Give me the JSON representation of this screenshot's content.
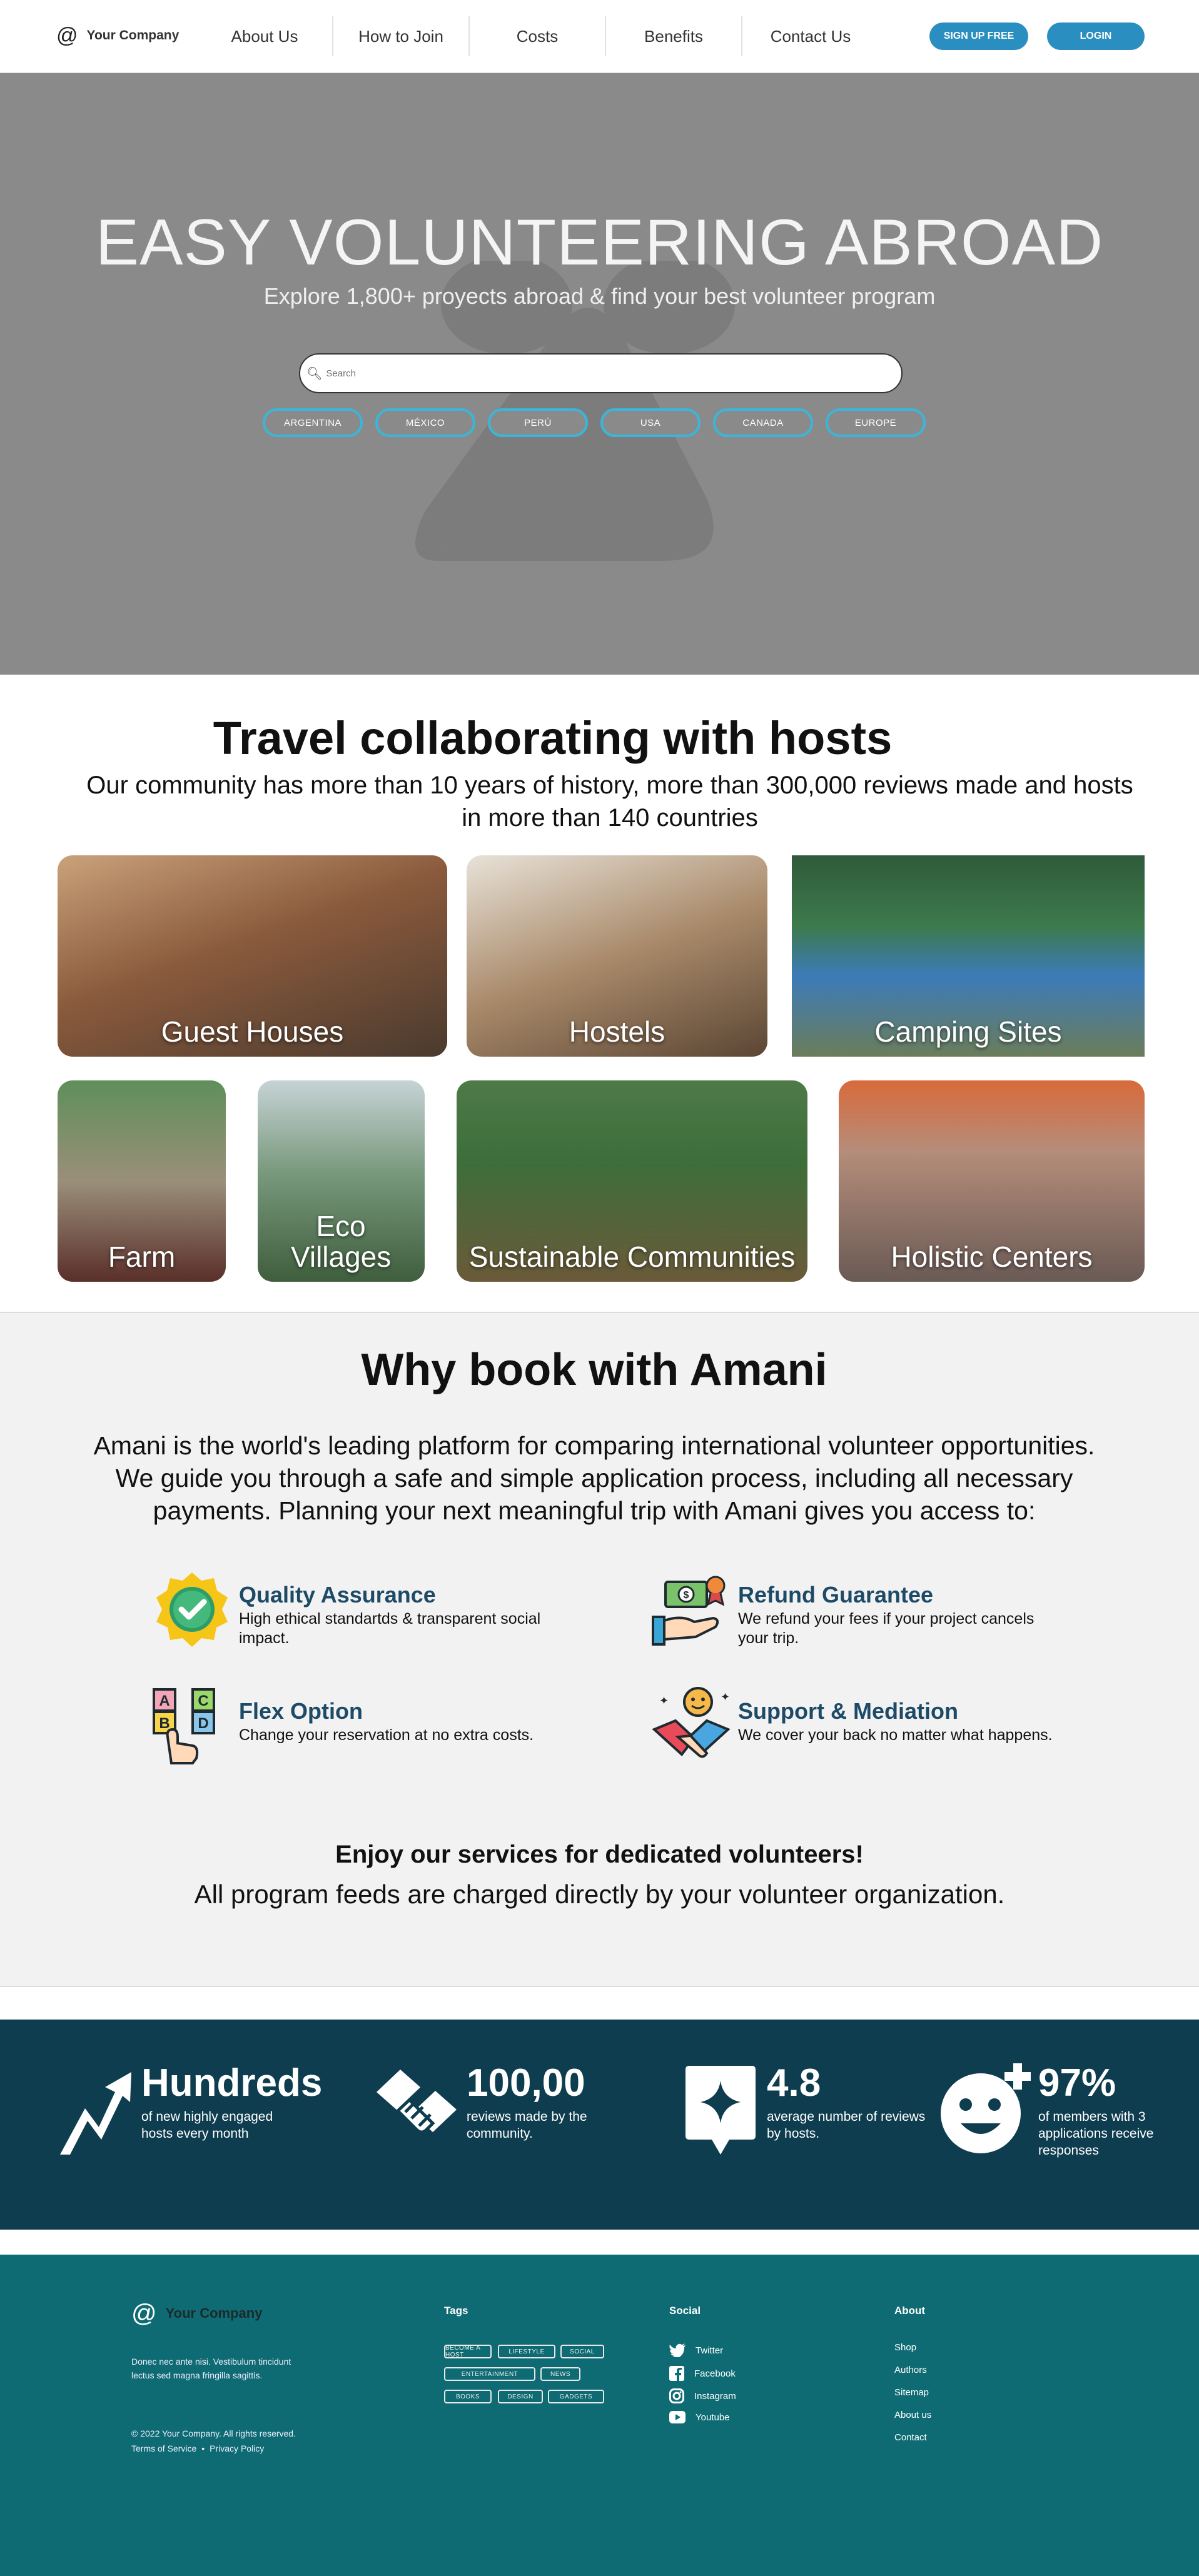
{
  "nav": {
    "company": "Your Company",
    "links": [
      "About Us",
      "How to Join",
      "Costs",
      "Benefits",
      "Contact Us"
    ],
    "signup": "SIGN UP FREE",
    "login": "LOGIN"
  },
  "hero": {
    "title": "EASY VOLUNTEERING ABROAD",
    "subtitle": "Explore 1,800+ proyects abroad & find your best volunteer program",
    "search_placeholder": "Search",
    "countries": [
      "ARGENTINA",
      "MÉXICO",
      "PERÚ",
      "USA",
      "CANADA",
      "EUROPE"
    ]
  },
  "travel": {
    "title": "Travel collaborating with hosts",
    "subtitle": "Our community has more than 10 years of history, more than 300,000 reviews made and hosts in more than 140 countries",
    "cards": [
      "Guest Houses",
      "Hostels",
      "Camping Sites",
      "Farm",
      "Eco Villages",
      "Sustainable Communities",
      "Holistic Centers"
    ]
  },
  "why": {
    "title": "Why book with Amani",
    "intro": "Amani is the world's leading platform for comparing international volunteer opportunities. We guide you through a safe and simple application process, including all necessary payments. Planning your next meaningful trip with Amani gives you access to:",
    "features": [
      {
        "title": "Quality Assurance",
        "desc": "High ethical standartds & transparent social impact.",
        "icon": "quality-badge-icon"
      },
      {
        "title": "Refund Guarantee",
        "desc": "We refund your fees if your project cancels your trip.",
        "icon": "money-hand-icon"
      },
      {
        "title": "Flex Option",
        "desc": "Change your reservation at no extra costs.",
        "icon": "abcd-blocks-icon"
      },
      {
        "title": "Support & Mediation",
        "desc": "We cover your back no matter what happens.",
        "icon": "handshake-icon"
      }
    ],
    "enjoy": "Enjoy our services for dedicated volunteers!",
    "feeds": "All program feeds are charged directly by your volunteer organization."
  },
  "stats": [
    {
      "big": "Hundreds",
      "small": "of new highly engaged hosts every month",
      "icon": "trend-arrow-icon"
    },
    {
      "big": "100,00",
      "small": "reviews made by the community.",
      "icon": "handshake-icon"
    },
    {
      "big": "4.8",
      "small": "average number of reviews by hosts.",
      "icon": "star-badge-icon"
    },
    {
      "big": "97%",
      "small": "of members with 3 applications receive responses",
      "icon": "smiley-plus-icon"
    }
  ],
  "footer": {
    "company": "Your Company",
    "blurb": "Donec nec ante nisi. Vestibulum tincidunt lectus sed magna fringilla sagittis.",
    "copyright": "© 2022 Your Company.  All rights reserved.",
    "terms": "Terms of Service",
    "privacy": "Privacy Policy",
    "tags_title": "Tags",
    "tags": [
      "BECOME A HOST",
      "LIFESTYLE",
      "SOCIAL",
      "ENTERTAINMENT",
      "NEWS",
      "BOOKS",
      "DESIGN",
      "GADGETS"
    ],
    "social_title": "Social",
    "social": [
      "Twitter",
      "Facebook",
      "Instagram",
      "Youtube"
    ],
    "about_title": "About",
    "about": [
      "Shop",
      "Authors",
      "Sitemap",
      "About us",
      "Contact"
    ]
  }
}
